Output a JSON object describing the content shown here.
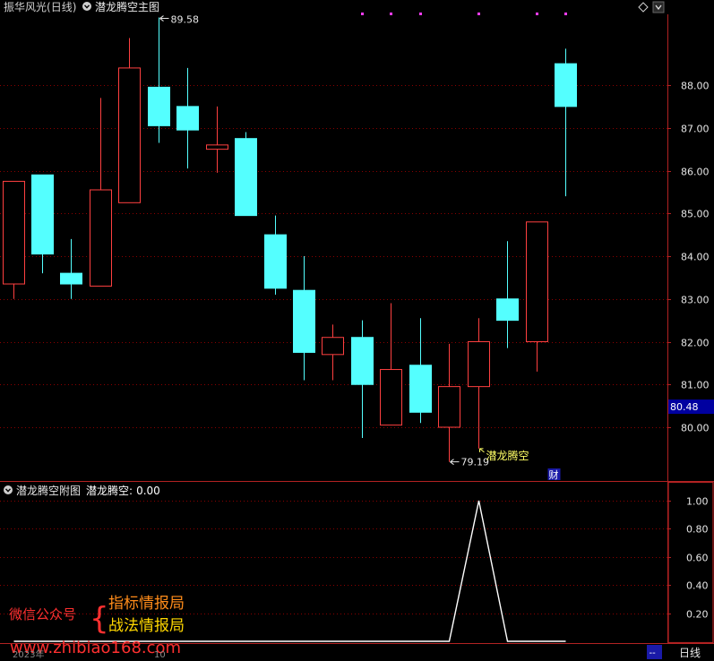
{
  "header": {
    "stock_name": "振华风光",
    "period": "(日线)",
    "main_indicator": "潜龙腾空主图"
  },
  "sub_header": {
    "indicator_name": "潜龙腾空附图",
    "value_label": "潜龙腾空:",
    "value": "0.00"
  },
  "watermark": {
    "wechat_label": "微信公众号",
    "line1": "指标情报局",
    "line2": "战法情报局",
    "url": "www.zhibiao168.com"
  },
  "bottom_bar": {
    "date_left": "2023年",
    "date_mid": "10",
    "dash": "--",
    "period_label": "日线"
  },
  "colors": {
    "up": "#ff4040",
    "down": "#54ffff",
    "grid": "#8b0000",
    "axis": "#b22222",
    "price_label": "#e6e6e6",
    "annotation": "#ffff66",
    "magenta": "#ff3cff",
    "current_price_box": "#0000a0",
    "signal_line": "#ffffff"
  },
  "chart_data": [
    {
      "type": "candlestick",
      "ylim": [
        78.9,
        89.8
      ],
      "yticks": [
        "88.00",
        "87.00",
        "86.00",
        "85.00",
        "84.00",
        "83.00",
        "82.00",
        "81.00",
        "80.00"
      ],
      "grid": true,
      "candles": [
        {
          "o": 83.35,
          "h": 85.75,
          "l": 83.0,
          "c": 85.75
        },
        {
          "o": 85.9,
          "h": 85.9,
          "l": 83.6,
          "c": 84.05
        },
        {
          "o": 83.6,
          "h": 84.4,
          "l": 83.0,
          "c": 83.35
        },
        {
          "o": 83.3,
          "h": 87.7,
          "l": 83.3,
          "c": 85.55
        },
        {
          "o": 85.25,
          "h": 89.1,
          "l": 85.25,
          "c": 88.4
        },
        {
          "o": 87.95,
          "h": 89.58,
          "l": 86.65,
          "c": 87.05
        },
        {
          "o": 87.5,
          "h": 88.4,
          "l": 86.05,
          "c": 86.95
        },
        {
          "o": 86.5,
          "h": 87.5,
          "l": 85.95,
          "c": 86.6
        },
        {
          "o": 86.75,
          "h": 86.9,
          "l": 84.95,
          "c": 84.95
        },
        {
          "o": 84.5,
          "h": 84.95,
          "l": 83.1,
          "c": 83.25
        },
        {
          "o": 83.2,
          "h": 84.0,
          "l": 81.1,
          "c": 81.75
        },
        {
          "o": 81.7,
          "h": 82.4,
          "l": 81.1,
          "c": 82.1
        },
        {
          "o": 82.1,
          "h": 82.5,
          "l": 79.75,
          "c": 81.0
        },
        {
          "o": 80.05,
          "h": 82.9,
          "l": 80.05,
          "c": 81.35
        },
        {
          "o": 81.45,
          "h": 82.55,
          "l": 80.1,
          "c": 80.35
        },
        {
          "o": 80.0,
          "h": 81.95,
          "l": 79.19,
          "c": 80.95
        },
        {
          "o": 80.95,
          "h": 82.55,
          "l": 79.5,
          "c": 82.0
        },
        {
          "o": 83.0,
          "h": 84.35,
          "l": 81.85,
          "c": 82.5
        },
        {
          "o": 82.0,
          "h": 84.8,
          "l": 81.3,
          "c": 84.8
        },
        {
          "o": 88.5,
          "h": 88.85,
          "l": 85.4,
          "c": 87.5
        }
      ],
      "annotations": {
        "high_label": "89.58",
        "high_index": 5,
        "low_label": "79.19",
        "low_index": 15,
        "signal_text": "潜龙腾空",
        "signal_index": 16,
        "fin_badge": "财",
        "fin_badge_index": 18,
        "current_price": "80.48",
        "current_price_value": 80.48,
        "top_marker_indices": [
          12,
          13,
          14,
          16,
          18,
          19
        ]
      }
    },
    {
      "type": "line",
      "name": "潜龙腾空",
      "ylim": [
        0,
        1.18
      ],
      "yticks": [
        "1.00",
        "0.80",
        "0.60",
        "0.40",
        "0.20"
      ],
      "grid": true,
      "values": [
        0,
        0,
        0,
        0,
        0,
        0,
        0,
        0,
        0,
        0,
        0,
        0,
        0,
        0,
        0,
        0,
        1,
        0,
        0,
        0
      ]
    }
  ]
}
